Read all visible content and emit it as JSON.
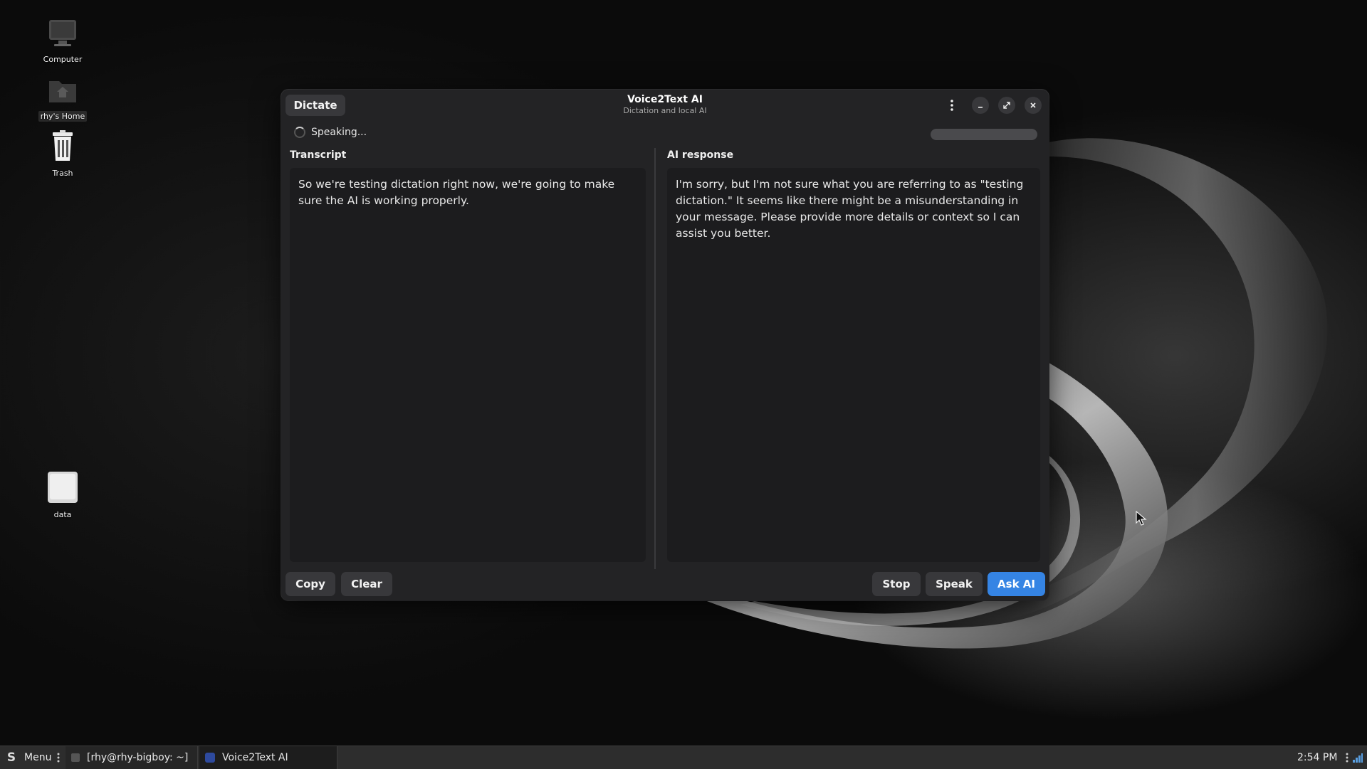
{
  "desktop": {
    "icons": [
      {
        "label": "Computer"
      },
      {
        "label": "rhy's Home"
      },
      {
        "label": "Trash"
      },
      {
        "label": "data"
      }
    ]
  },
  "window": {
    "dictate_label": "Dictate",
    "title": "Voice2Text AI",
    "subtitle": "Dictation and local AI",
    "status_text": "Speaking...",
    "transcript": {
      "label": "Transcript",
      "text": "So we're testing dictation right now, we're going to make sure the AI is working properly."
    },
    "ai_response": {
      "label": "AI response",
      "text": "I'm sorry, but I'm not sure what you are referring to as \"testing dictation.\" It seems like there might be a misunderstanding in your message. Please provide more details or context so I can assist you better."
    },
    "buttons": {
      "copy": "Copy",
      "clear": "Clear",
      "stop": "Stop",
      "speak": "Speak",
      "ask_ai": "Ask AI"
    },
    "accent_color": "#3584e4"
  },
  "taskbar": {
    "menu_label": "Menu",
    "windows": [
      {
        "label": "[rhy@rhy-bigboy: ~]"
      },
      {
        "label": "Voice2Text AI"
      }
    ],
    "clock": "2:54 PM"
  }
}
